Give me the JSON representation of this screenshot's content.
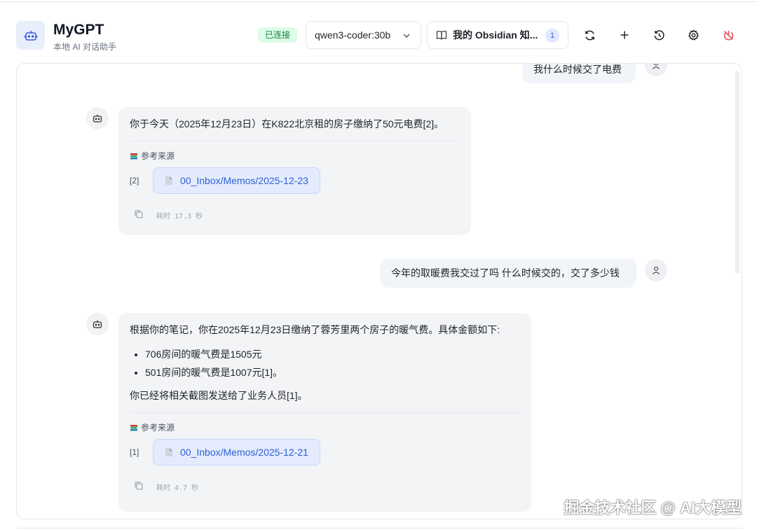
{
  "header": {
    "title": "MyGPT",
    "subtitle": "本地 AI 对话助手",
    "status": "已连接",
    "model": "qwen3-coder:30b",
    "knowledge_base": "我的 Obsidian 知...",
    "knowledge_count": "1",
    "icons": [
      "robot-icon",
      "refresh-icon",
      "plus-icon",
      "history-icon",
      "gear-icon",
      "power-icon"
    ]
  },
  "messages": [
    {
      "role": "user",
      "text": "我什么时候交了电费"
    },
    {
      "role": "assistant",
      "text": "你于今天（2025年12月23日）在K822北京租的房子缴纳了50元电费[2]。",
      "sources_title": "参考来源",
      "sources": [
        {
          "index": "[2]",
          "label": "00_Inbox/Memos/2025-12-23"
        }
      ],
      "elapsed": "耗时 17.3 秒"
    },
    {
      "role": "user",
      "text": "今年的取暖费我交过了吗 什么时候交的，交了多少钱"
    },
    {
      "role": "assistant",
      "text": "根据你的笔记，你在2025年12月23日缴纳了蓉芳里两个房子的暖气费。具体金额如下:",
      "bullets": [
        "706房间的暖气费是1505元",
        "501房间的暖气费是1007元[1]。"
      ],
      "after": "你已经将相关截图发送给了业务人员[1]。",
      "sources_title": "参考来源",
      "sources": [
        {
          "index": "[1]",
          "label": "00_Inbox/Memos/2025-12-21"
        }
      ],
      "elapsed": "耗时 4.7 秒"
    }
  ],
  "watermark": "掘金技术社区 @ AI大模型",
  "colors": {
    "accent": "#2f5fd0",
    "status_bg": "#dcfce7",
    "status_text": "#15803d",
    "power": "#e5484d"
  }
}
